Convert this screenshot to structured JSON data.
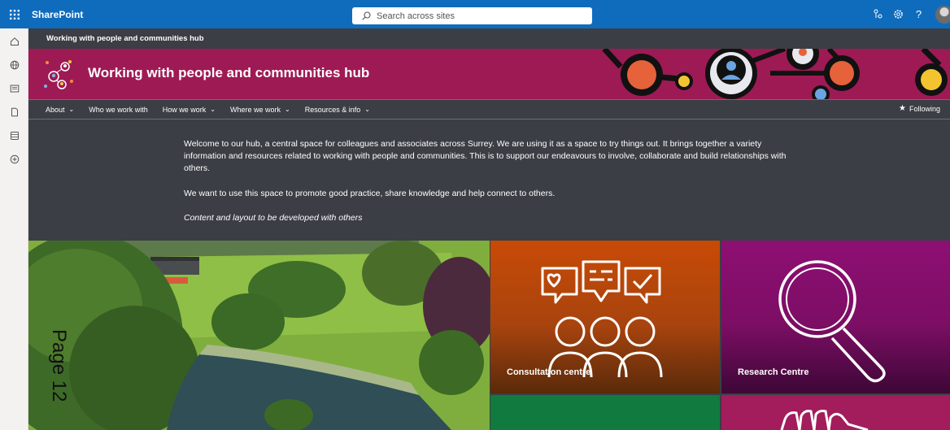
{
  "topbar": {
    "app_name": "SharePoint",
    "search_placeholder": "Search across sites",
    "icons": [
      "app-launcher-icon",
      "search-icon",
      "share-network-icon",
      "settings-icon",
      "help-icon",
      "avatar"
    ],
    "help_label": "?"
  },
  "leftrail": {
    "icons": [
      "home-icon",
      "globe-icon",
      "news-icon",
      "document-icon",
      "list-icon",
      "add-icon"
    ]
  },
  "site": {
    "breadcrumb_title": "Working with people and communities hub",
    "banner_title": "Working with people and communities hub"
  },
  "nav": {
    "items": [
      {
        "label": "About",
        "has_chevron": true
      },
      {
        "label": "Who we work with",
        "has_chevron": false
      },
      {
        "label": "How we work",
        "has_chevron": true
      },
      {
        "label": "Where we work",
        "has_chevron": true
      },
      {
        "label": "Resources & info",
        "has_chevron": true
      }
    ],
    "following_label": "Following"
  },
  "welcome": {
    "paragraph1": "Welcome to our hub, a central space for colleagues and associates across Surrey. We are using it as a space to try things out. It brings together a variety information and resources related to working with people and communities. This is to support our endeavours to involve, collaborate and build relationships with others.",
    "paragraph2": "We want to use this space to promote good practice, share knowledge and help connect to others.",
    "paragraph3": "Content and layout to be developed with others"
  },
  "overlay": {
    "page_mark": "Page 12"
  },
  "tiles": [
    {
      "label": "Consultation centre",
      "color": "#c84a06"
    },
    {
      "label": "Research Centre",
      "color": "#8e0f73"
    },
    {
      "label": "",
      "color": "#117a3f"
    },
    {
      "label": "",
      "color": "#a31c5b"
    }
  ],
  "colors": {
    "suite_bar": "#0f6cbd",
    "banner": "#9e1a54",
    "background": "#3b3e44"
  }
}
